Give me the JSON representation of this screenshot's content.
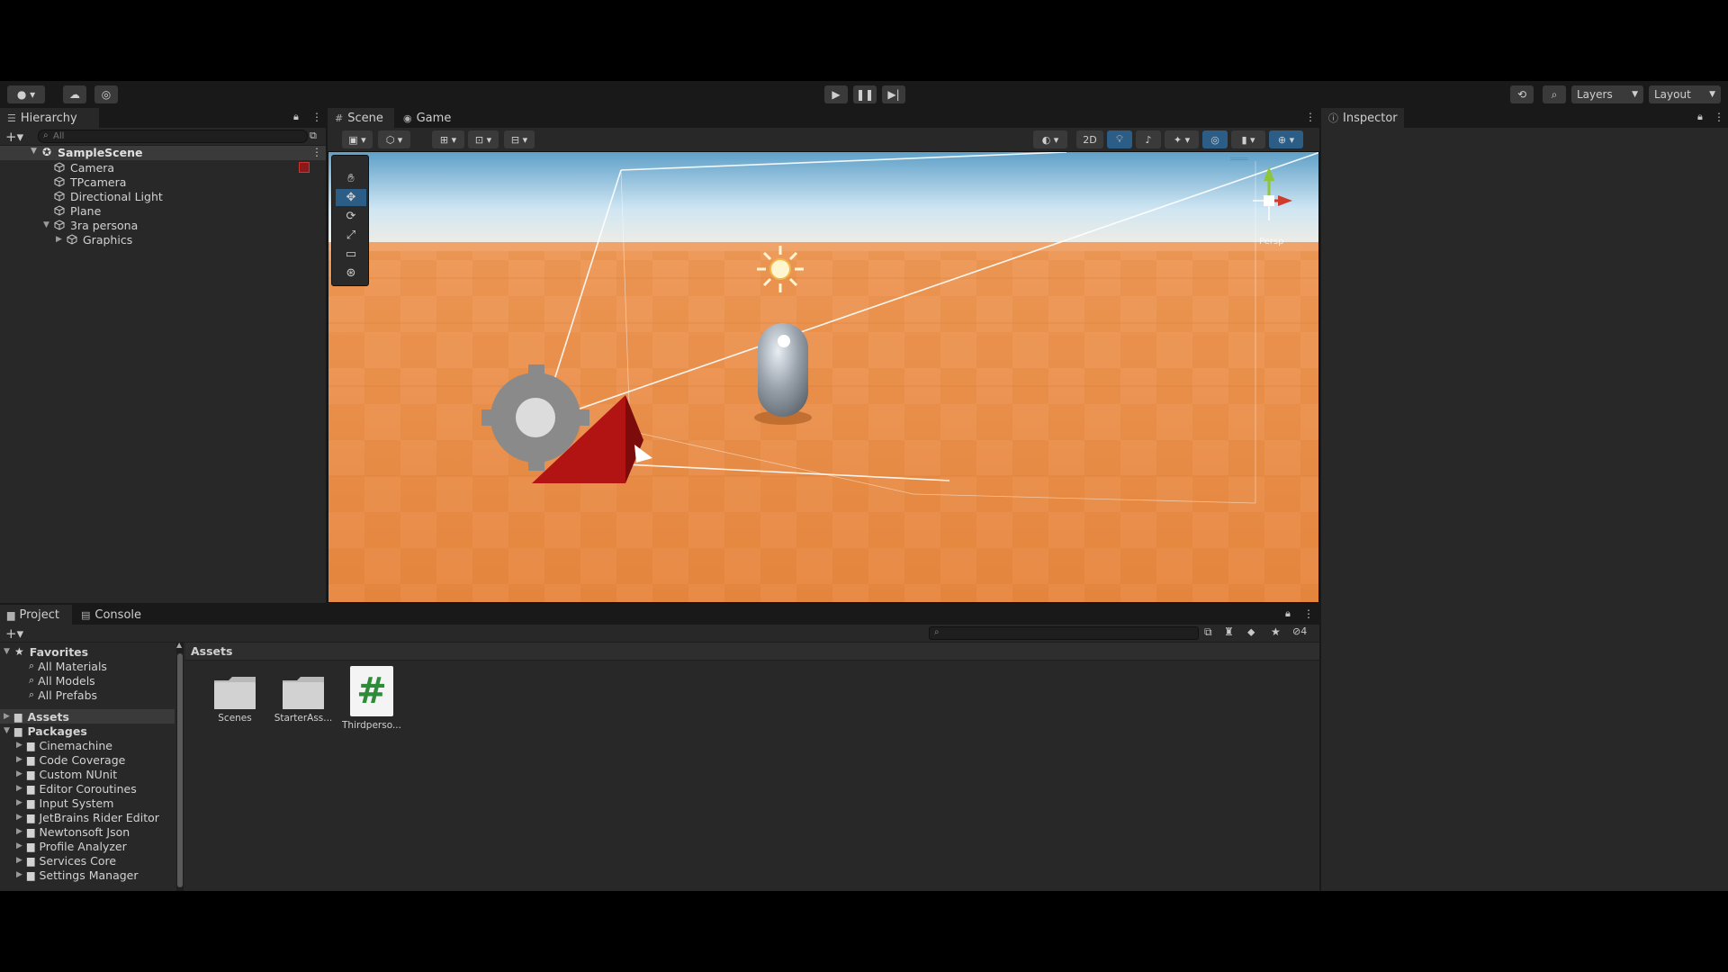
{
  "toolbar": {
    "layers_label": "Layers",
    "layout_label": "Layout"
  },
  "hierarchy": {
    "tab_label": "Hierarchy",
    "search_placeholder": "All",
    "scene_name": "SampleScene",
    "items": [
      {
        "label": "Camera"
      },
      {
        "label": "TPcamera"
      },
      {
        "label": "Directional Light"
      },
      {
        "label": "Plane"
      },
      {
        "label": "3ra persona"
      },
      {
        "label": "Graphics"
      }
    ]
  },
  "scene_view": {
    "tabs": [
      {
        "label": "Scene"
      },
      {
        "label": "Game"
      }
    ],
    "toggle_2d_label": "2D",
    "gizmo_label": "Persp"
  },
  "inspector": {
    "tab_label": "Inspector"
  },
  "project": {
    "tabs": [
      {
        "label": "Project"
      },
      {
        "label": "Console"
      }
    ],
    "hidden_count": "4",
    "favorites": {
      "label": "Favorites",
      "items": [
        {
          "label": "All Materials"
        },
        {
          "label": "All Models"
        },
        {
          "label": "All Prefabs"
        }
      ]
    },
    "assets_root_label": "Assets",
    "packages": {
      "label": "Packages",
      "items": [
        {
          "label": "Cinemachine"
        },
        {
          "label": "Code Coverage"
        },
        {
          "label": "Custom NUnit"
        },
        {
          "label": "Editor Coroutines"
        },
        {
          "label": "Input System"
        },
        {
          "label": "JetBrains Rider Editor"
        },
        {
          "label": "Newtonsoft Json"
        },
        {
          "label": "Profile Analyzer"
        },
        {
          "label": "Services Core"
        },
        {
          "label": "Settings Manager"
        }
      ]
    },
    "breadcrumb": "Assets",
    "assets": [
      {
        "label": "Scenes"
      },
      {
        "label": "StarterAss..."
      },
      {
        "label": "Thirdperso..."
      }
    ]
  },
  "colors": {
    "accent": "#2c5d87",
    "ground": "#e58a3e",
    "sky": "#cfe6f3",
    "panel": "#282828",
    "script_icon": "#2e8b3a"
  }
}
